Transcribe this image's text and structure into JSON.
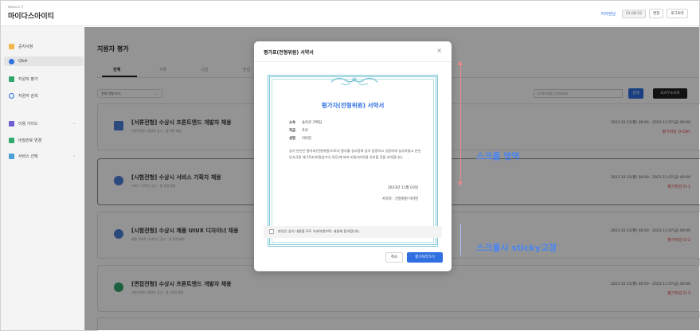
{
  "header": {
    "logo_small": "MIRACLE IT",
    "logo": "마이다스아이티",
    "user": "이아현님",
    "timer": "01:08:52",
    "extend_label": "연장",
    "logout_label": "로그아웃"
  },
  "sidebar": {
    "items": [
      {
        "label": "공지사항",
        "color": "#f2b84b"
      },
      {
        "label": "Q&A",
        "color": "#2f6fe0"
      },
      {
        "label": "지원자 평가",
        "color": "#2fa86e"
      },
      {
        "label": "지원자 검색",
        "color": "#2f6fe0"
      },
      {
        "label": "이용 가이드",
        "color": "#6b5fd3"
      },
      {
        "label": "비밀번호 변경",
        "color": "#2fa86e"
      },
      {
        "label": "서비스 선택",
        "color": "#4a9fd8"
      }
    ]
  },
  "main": {
    "title": "지원자 평가",
    "tabs": [
      "전체",
      "서류",
      "시험",
      "면접"
    ],
    "filter": "전체 전형 보기",
    "search_placeholder": "Q 평가명을 입력하세요",
    "search_btn": "검색",
    "ica_btn": "ICA무소속처"
  },
  "cards": [
    {
      "title": "[서류전형] 수상시 프론트엔드 개발자 채용",
      "sub": "프론트엔드 개발자 공고 · 총 8명 배정",
      "date": "2023.10.31(월) 00:00 - 2023.11.07(금) 00:00",
      "dday": "평가마감 D-DAY",
      "icon_color": "#4a7fd8"
    },
    {
      "title": "[시험전형] 수상시 서비스 기획자 채용",
      "sub": "서비스 기획자 공고 · 총 4명 배정",
      "date": "2023.10.31(월) 00:00 - 2023.11.07(금) 00:00",
      "dday": "평가마감 D-1",
      "icon_color": "#4a7fd8"
    },
    {
      "title": "[시험전형] 수상시 제품 UIUX 디자이너 채용",
      "sub": "제품 UIUX 디자이너 공고 · 총 6명 배정",
      "date": "2023.10.31(월) 00:00 - 2023.11.07(금) 00:00",
      "dday": "평가마감 D-2",
      "icon_color": "#4a7fd8"
    },
    {
      "title": "[면접전형] 수상시 프론트엔드 개발자 채용",
      "sub": "프론트엔드 개발자 공고 · 총 10명 배정",
      "date": "2023.10.31(월) 00:00 - 2023.11.07(금) 00:00",
      "dday": "평가마감 D-3",
      "icon_color": "#2fa86e"
    }
  ],
  "modal": {
    "title": "평가표(전형위원) 서약서",
    "close": "×",
    "cert_title": "평가자(전형위원) 서약서",
    "rows": [
      {
        "k": "소속",
        "v": "솔루션 기획팀"
      },
      {
        "k": "직급",
        "v": "프로"
      },
      {
        "k": "성명",
        "v": "이아현"
      }
    ],
    "body": "상기 본인은 평가자(전형위원)으로서 평가를 실시함에 있어 엄정하고 공정하게 심사하였고 본인 인사규정 제 25조(비밀엄수의 의무)에 따라 비밀(보안)을 유지할 것을 서약합니다.",
    "date": "2023년 11월 03일",
    "sign": "서약자 : 전형위원 이아현",
    "agree": "본인은 상기 내용을 모두 숙지하였으며, 내용에 동의합니다.",
    "cancel": "취소",
    "confirm": "평가하러가기"
  },
  "annotations": {
    "scroll_area": "스크롤 영역",
    "sticky": "스크롤시 sticky고정"
  }
}
